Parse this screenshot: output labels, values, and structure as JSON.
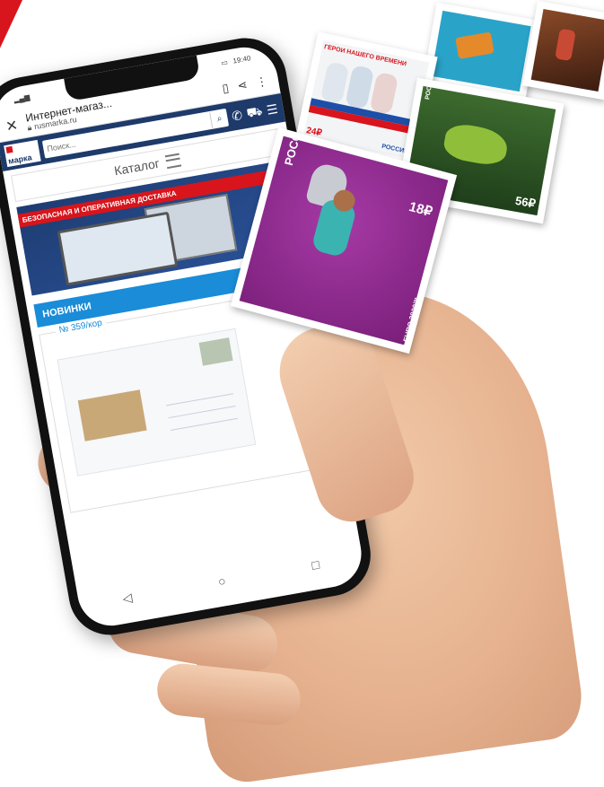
{
  "phone": {
    "status_time": "19:40",
    "browser": {
      "page_title": "Интернет-магаз...",
      "url": "rusmarka.ru"
    },
    "site": {
      "logo_text": "марка",
      "search_placeholder": "Поиск...",
      "catalog_label": "Каталог",
      "banner_text": "БЕЗОПАСНАЯ И ОПЕРАТИВНАЯ ДОСТАВКА",
      "news_label": "НОВИНКИ",
      "product_code": "№ 359/кор"
    }
  },
  "stamps": {
    "heroes": {
      "title": "ГЕРОИ НАШЕГО ВРЕМЕНИ",
      "country": "РОССИЯ",
      "value": "24₽"
    },
    "euro": {
      "country": "РОССИЯ",
      "value": "18₽",
      "caption": "UEFA EURO 2020™"
    },
    "frog": {
      "country": "РОССИЯ",
      "value": "56₽"
    }
  },
  "colors": {
    "brand_red": "#d8151c",
    "site_navy": "#1d3a6a",
    "news_blue": "#1a8cd8",
    "stamp_purple": "#8e2a8e"
  }
}
